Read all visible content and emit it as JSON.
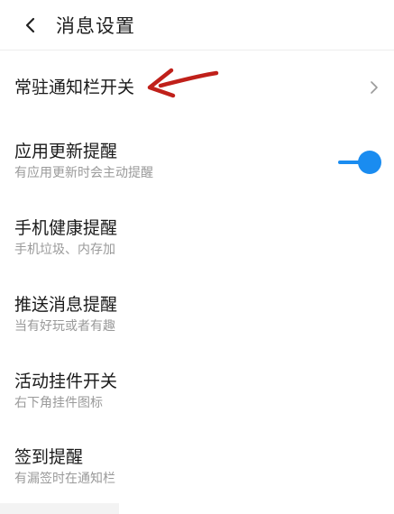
{
  "header": {
    "title": "消息设置"
  },
  "rows": [
    {
      "title": "常驻通知栏开关",
      "subtitle": ""
    },
    {
      "title": "应用更新提醒",
      "subtitle": "有应用更新时会主动提醒",
      "toggle_on": true
    },
    {
      "title": "手机健康提醒",
      "subtitle": "手机垃圾、内存加"
    },
    {
      "title": "推送消息提醒",
      "subtitle": "当有好玩或者有趣"
    },
    {
      "title": "活动挂件开关",
      "subtitle": "右下角挂件图标"
    },
    {
      "title": "签到提醒",
      "subtitle": "有漏签时在通知栏"
    }
  ],
  "colors": {
    "accent": "#1a8cf0",
    "annotation_arrow": "#c0201a",
    "title_text": "#1a1a1a",
    "subtitle_text": "#9a9a9a",
    "divider": "#eeeeee"
  },
  "icons": {
    "back": "chevron-left-icon",
    "row_chevron": "chevron-right-icon"
  }
}
